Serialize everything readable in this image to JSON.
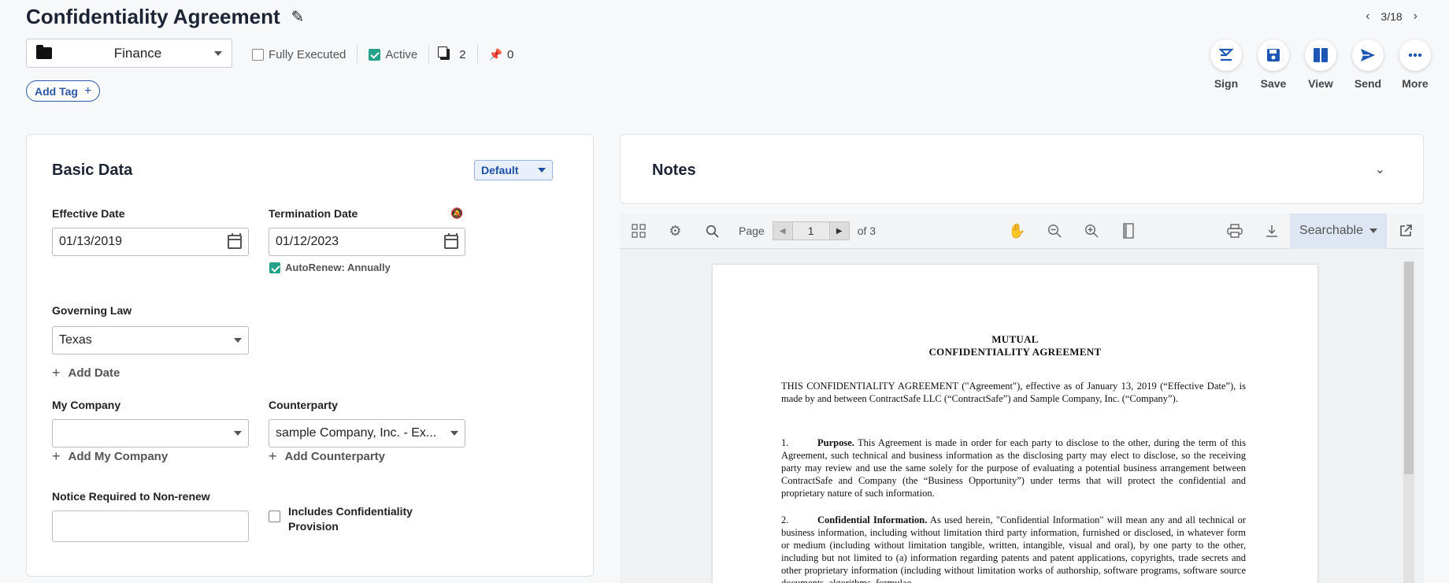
{
  "header": {
    "title": "Confidentiality Agreement",
    "pager": "3/18"
  },
  "folder": {
    "label": "Finance"
  },
  "status": {
    "fully_executed": "Fully Executed",
    "active": "Active",
    "docs_count": "2",
    "pins_count": "0"
  },
  "add_tag": "Add Tag",
  "actions": [
    {
      "label": "Sign",
      "icon": "sign-icon"
    },
    {
      "label": "Save",
      "icon": "save-icon"
    },
    {
      "label": "View",
      "icon": "view-icon"
    },
    {
      "label": "Send",
      "icon": "send-icon"
    },
    {
      "label": "More",
      "icon": "more-icon"
    }
  ],
  "basic": {
    "title": "Basic Data",
    "view_mode": "Default",
    "effective_date_label": "Effective Date",
    "effective_date": "01/13/2019",
    "termination_date_label": "Termination Date",
    "termination_date": "01/12/2023",
    "autorenew": "AutoRenew: Annually",
    "governing_law_label": "Governing Law",
    "governing_law": "Texas",
    "add_date": "Add Date",
    "my_company_label": "My Company",
    "my_company": "",
    "add_my_company": "Add My Company",
    "counterparty_label": "Counterparty",
    "counterparty": "sample Company, Inc. - Ex...",
    "add_counterparty": "Add Counterparty",
    "notice_label": "Notice Required to Non-renew",
    "conf_provision_label_1": "Includes Confidentiality",
    "conf_provision_label_2": "Provision"
  },
  "notes": {
    "title": "Notes"
  },
  "viewer": {
    "page_label": "Page",
    "page": "1",
    "of": "of 3",
    "mode": "Searchable"
  },
  "document": {
    "heading1": "MUTUAL",
    "heading2": "CONFIDENTIALITY AGREEMENT",
    "intro": "THIS CONFIDENTIALITY AGREEMENT (\"Agreement\"), effective as of January 13, 2019 (“Effective Date”), is made by and between ContractSafe LLC (“ContractSafe”) and Sample Company, Inc. (“Company”).",
    "p1_num": "1.",
    "p1_title": "Purpose.",
    "p1_text": "This Agreement is made in order for each party to disclose to the other, during the term of this Agreement, such technical and business information as the disclosing party may elect to disclose, so the receiving party may review and use the same solely for the purpose of evaluating a potential business arrangement between ContractSafe and Company (the “Business Opportunity”) under terms that will protect the confidential and proprietary nature of such information.",
    "p2_num": "2.",
    "p2_title": "Confidential Information.",
    "p2_text": "As used herein, \"Confidential Information\" will mean any and all technical or business information, including without limitation third party information, furnished or disclosed, in whatever form or medium (including without limitation tangible, written, intangible, visual and oral), by one party to the other, including but not limited to (a) information regarding patents and patent applications, copyrights, trade secrets and other proprietary information (including without limitation works of authorship, software programs, software source documents, algorithms, formulae,"
  }
}
